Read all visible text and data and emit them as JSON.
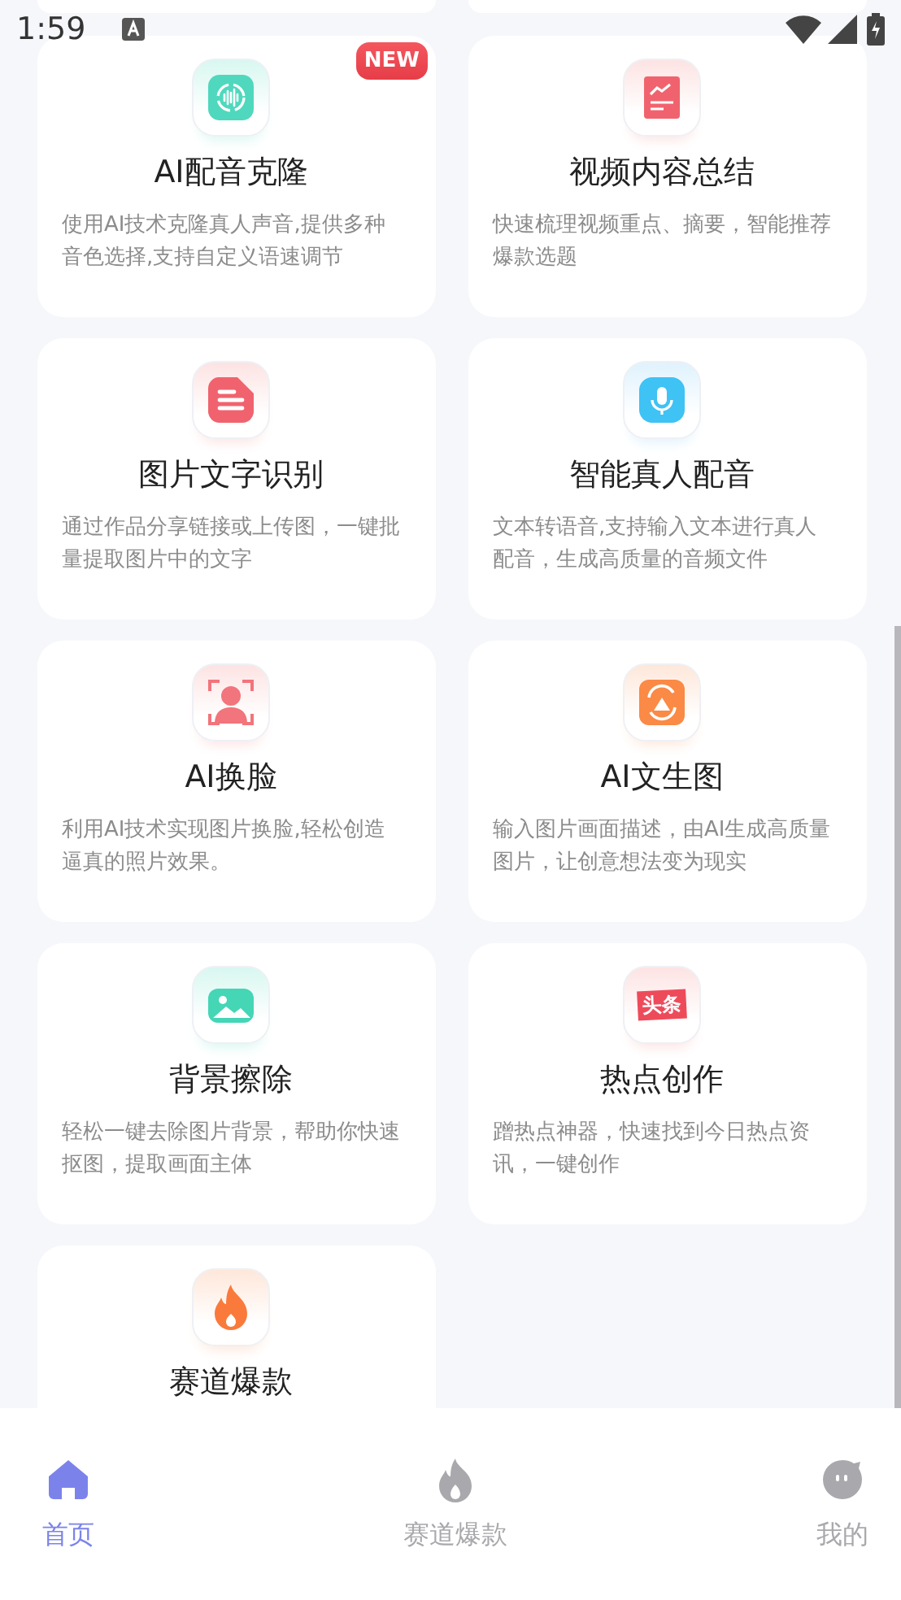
{
  "status_bar": {
    "time": "1:59"
  },
  "cards": [
    {
      "kind": "wave",
      "title": "AI配音克隆",
      "description": "使用AI技术克隆真人声音,提供多种音色选择,支持自定义语速调节",
      "badge": "NEW"
    },
    {
      "kind": "chart",
      "title": "视频内容总结",
      "description": "快速梳理视频重点、摘要，智能推荐爆款选题"
    },
    {
      "kind": "doc",
      "title": "图片文字识别",
      "description": "通过作品分享链接或上传图，一键批量提取图片中的文字"
    },
    {
      "kind": "mic",
      "title": "智能真人配音",
      "description": "文本转语音,支持输入文本进行真人配音，生成高质量的音频文件"
    },
    {
      "kind": "face",
      "title": "AI换脸",
      "description": "利用AI技术实现图片换脸,轻松创造逼真的照片效果。"
    },
    {
      "kind": "scan",
      "title": "AI文生图",
      "description": "输入图片画面描述，由AI生成高质量图片，让创意想法变为现实"
    },
    {
      "kind": "picture",
      "title": "背景擦除",
      "description": "轻松一键去除图片背景，帮助你快速抠图，提取画面主体"
    },
    {
      "kind": "label",
      "icon_label": "头条",
      "title": "热点创作",
      "description": "蹭热点神器，快速找到今日热点资讯，一键创作"
    },
    {
      "kind": "fire",
      "title": "赛道爆款"
    }
  ],
  "nav": [
    {
      "kind": "home",
      "label": "首页",
      "selected": true
    },
    {
      "kind": "fire",
      "label": "赛道爆款",
      "selected": false
    },
    {
      "kind": "blob",
      "label": "我的",
      "selected": false
    }
  ]
}
